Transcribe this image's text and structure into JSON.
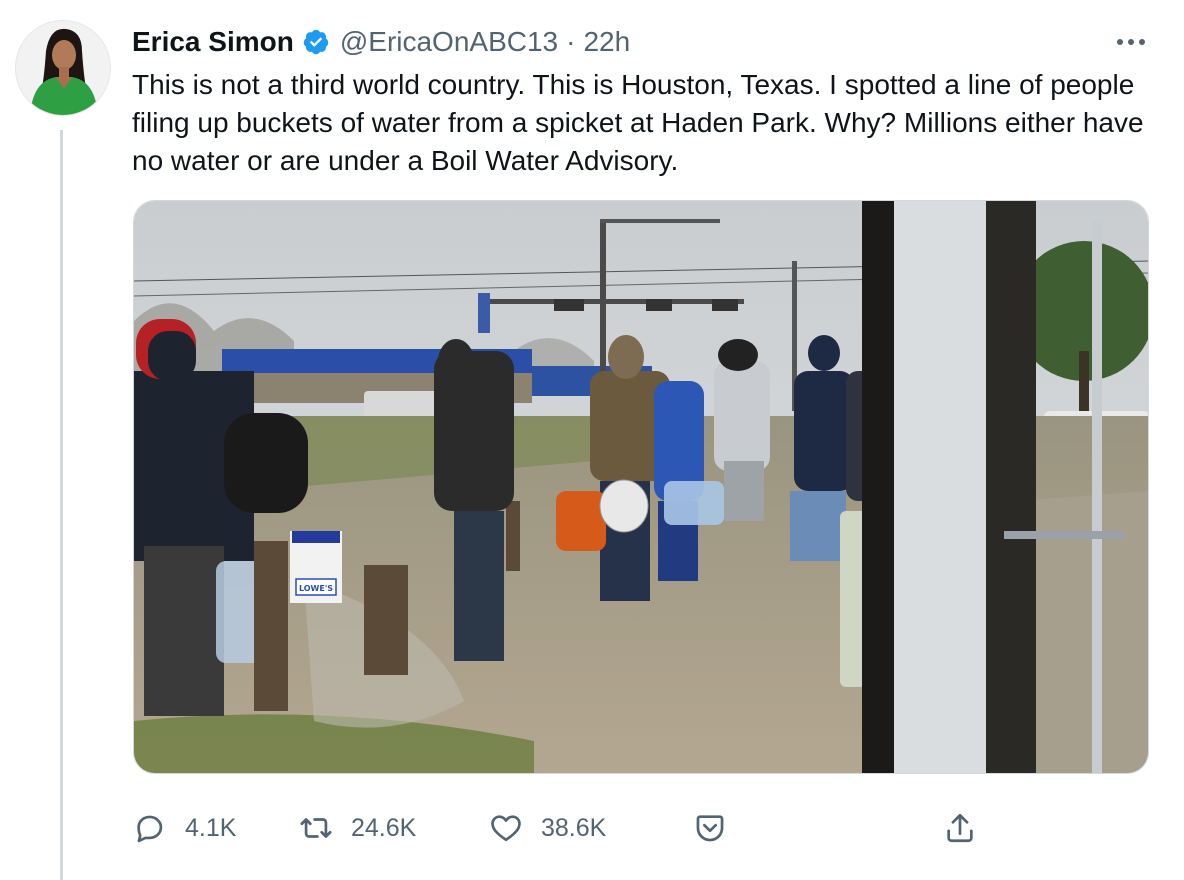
{
  "tweet": {
    "author": {
      "display_name": "Erica Simon",
      "handle": "@EricaOnABC13",
      "verified": true,
      "avatar_icon": "profile-photo"
    },
    "separator": "·",
    "time": "22h",
    "text": "This is not a third world country. This is Houston, Texas. I spotted a line of people filing up buckets of water from a spicket at Haden Park. Why? Millions either have no water or are under a Boil Water Advisory.",
    "media": {
      "sign_text": "LOWE'S"
    },
    "actions": {
      "reply": {
        "icon": "reply-icon",
        "count": "4.1K"
      },
      "retweet": {
        "icon": "retweet-icon",
        "count": "24.6K"
      },
      "like": {
        "icon": "heart-icon",
        "count": "38.6K"
      },
      "save": {
        "icon": "save-icon"
      },
      "share": {
        "icon": "share-icon"
      }
    }
  },
  "colors": {
    "text": "#0f1419",
    "secondary": "#536471",
    "verified": "#1d9bf0",
    "border": "#cfd9de"
  }
}
